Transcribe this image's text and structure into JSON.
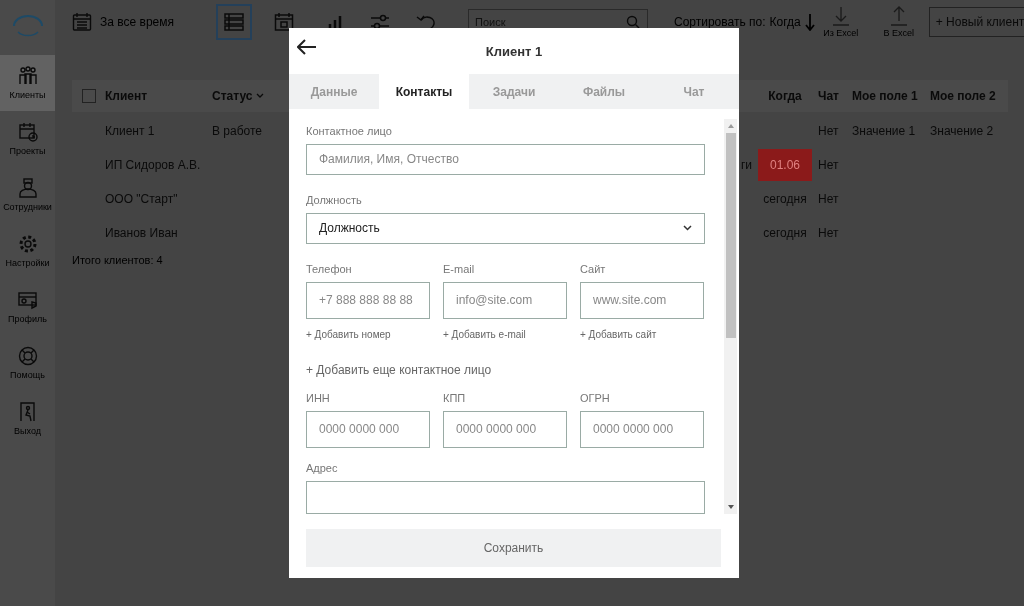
{
  "toolbar": {
    "period": "За все время",
    "views": [
      {
        "kind": "list",
        "selected": true
      },
      {
        "kind": "calendar",
        "selected": false
      }
    ],
    "search": {
      "placeholder": "Поиск"
    },
    "sort_label": "Сортировать по:",
    "sort_value": "Когда",
    "import_label": "Из Excel",
    "export_label": "В Excel",
    "new_button": "+ Новый клиент"
  },
  "sidebar": {
    "items": [
      {
        "kind": "clients",
        "label": "Клиенты",
        "selected": true
      },
      {
        "kind": "projects",
        "label": "Проекты",
        "selected": false
      },
      {
        "kind": "staff",
        "label": "Сотрудники",
        "selected": false
      },
      {
        "kind": "settings",
        "label": "Настройки",
        "selected": false
      },
      {
        "kind": "profile",
        "label": "Профиль",
        "selected": false
      },
      {
        "kind": "help",
        "label": "Помощь",
        "selected": false
      },
      {
        "kind": "exit",
        "label": "Выход",
        "selected": false
      }
    ]
  },
  "table": {
    "select_all_checked": false,
    "columns": {
      "client": "Клиент",
      "status": "Статус",
      "when": "Когда",
      "chat": "Чат",
      "field1": "Мое поле 1",
      "field2": "Мое поле 2"
    },
    "rows": [
      {
        "client": "Клиент 1",
        "status": "В работе",
        "chat": "Нет",
        "field1": "Значение 1",
        "field2": "Значение 2"
      },
      {
        "client": "ИП Сидоров А.В.",
        "column_3": "ги",
        "when": "01.06",
        "overdue": true,
        "chat": "Нет"
      },
      {
        "client": "ООО \"Старт\"",
        "when": "сегодня",
        "overdue": false,
        "chat": "Нет"
      },
      {
        "client": "Иванов Иван",
        "when": "сегодня",
        "overdue": false,
        "chat": "Нет"
      }
    ],
    "total": "Итого клиентов: 4"
  },
  "modal": {
    "title": "Клиент 1",
    "tabs": [
      {
        "label": "Данные",
        "selected": false
      },
      {
        "label": "Контакты",
        "selected": true
      },
      {
        "label": "Задачи",
        "selected": false
      },
      {
        "label": "Файлы",
        "selected": false
      },
      {
        "label": "Чат",
        "selected": false
      }
    ],
    "contact": {
      "label": "Контактное лицо",
      "placeholder": "Фамилия, Имя, Отчество"
    },
    "position": {
      "label": "Должность",
      "value": "Должность"
    },
    "channels": [
      {
        "label": "Телефон",
        "placeholder": "+7 888 888 88 88",
        "add_link": "+ Добавить номер"
      },
      {
        "label": "E-mail",
        "placeholder": "info@site.com",
        "add_link": "+ Добавить e-mail"
      },
      {
        "label": "Сайт",
        "placeholder": "www.site.com",
        "add_link": "+ Добавить сайт"
      }
    ],
    "add_contact": "+ Добавить еще контактное лицо",
    "requisites": [
      {
        "label": "ИНН",
        "placeholder": "0000 0000 000"
      },
      {
        "label": "КПП",
        "placeholder": "0000 0000 000"
      },
      {
        "label": "ОГРН",
        "placeholder": "0000 0000 000"
      }
    ],
    "address": {
      "label": "Адрес"
    },
    "save": "Сохранить"
  }
}
